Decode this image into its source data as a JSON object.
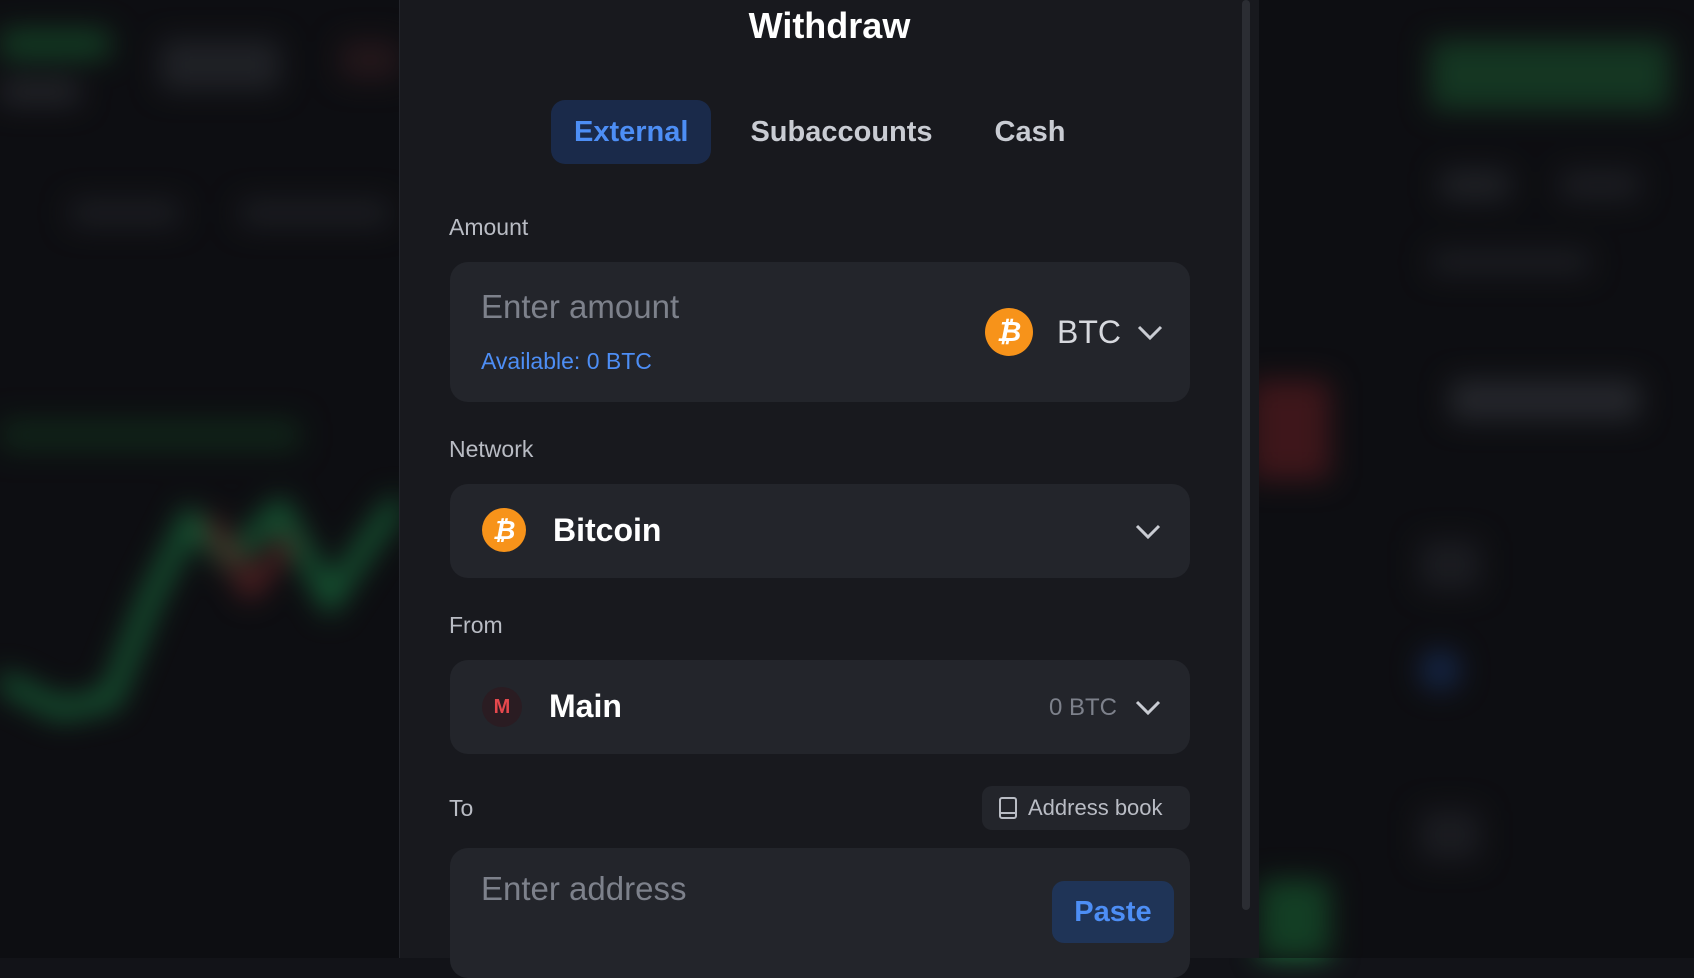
{
  "modal": {
    "title": "Withdraw",
    "tabs": [
      {
        "label": "External",
        "active": true
      },
      {
        "label": "Subaccounts",
        "active": false
      },
      {
        "label": "Cash",
        "active": false
      }
    ]
  },
  "amount": {
    "label": "Amount",
    "placeholder": "Enter amount",
    "available": "Available: 0 BTC",
    "currency": "BTC",
    "currency_icon": "bitcoin-icon"
  },
  "network": {
    "label": "Network",
    "value": "Bitcoin",
    "icon": "bitcoin-icon"
  },
  "from": {
    "label": "From",
    "account_initial": "M",
    "account_name": "Main",
    "balance": "0 BTC"
  },
  "to": {
    "label": "To",
    "address_book_label": "Address book",
    "address_book_icon": "book-icon",
    "placeholder": "Enter address",
    "paste_label": "Paste"
  },
  "colors": {
    "accent": "#4d8ef5",
    "bitcoin": "#f7931a",
    "panel": "#18191e",
    "field": "#23252b"
  }
}
